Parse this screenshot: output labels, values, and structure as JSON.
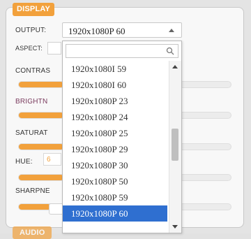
{
  "section_tab": "DISPLAY",
  "bottom_tab": "AUDIO",
  "labels": {
    "output": "OUTPUT:",
    "aspect": "ASPECT:",
    "contrast": "CONTRAS",
    "brightness": "BRIGHTN",
    "saturation": "SATURAT",
    "hue": "HUE:",
    "sharpness": "SHARPNE"
  },
  "hue_value": "6",
  "output_select": {
    "value": "1920x1080P 60"
  },
  "dropdown": {
    "search_value": "",
    "options": [
      "1920x1080I 59",
      "1920x1080I 60",
      "1920x1080P 23",
      "1920x1080P 24",
      "1920x1080P 25",
      "1920x1080P 29",
      "1920x1080P 30",
      "1920x1080P 50",
      "1920x1080P 59",
      "1920x1080P 60"
    ],
    "selected_index": 9
  },
  "colors": {
    "accent": "#f2a13c",
    "selection": "#2f6fd0"
  }
}
